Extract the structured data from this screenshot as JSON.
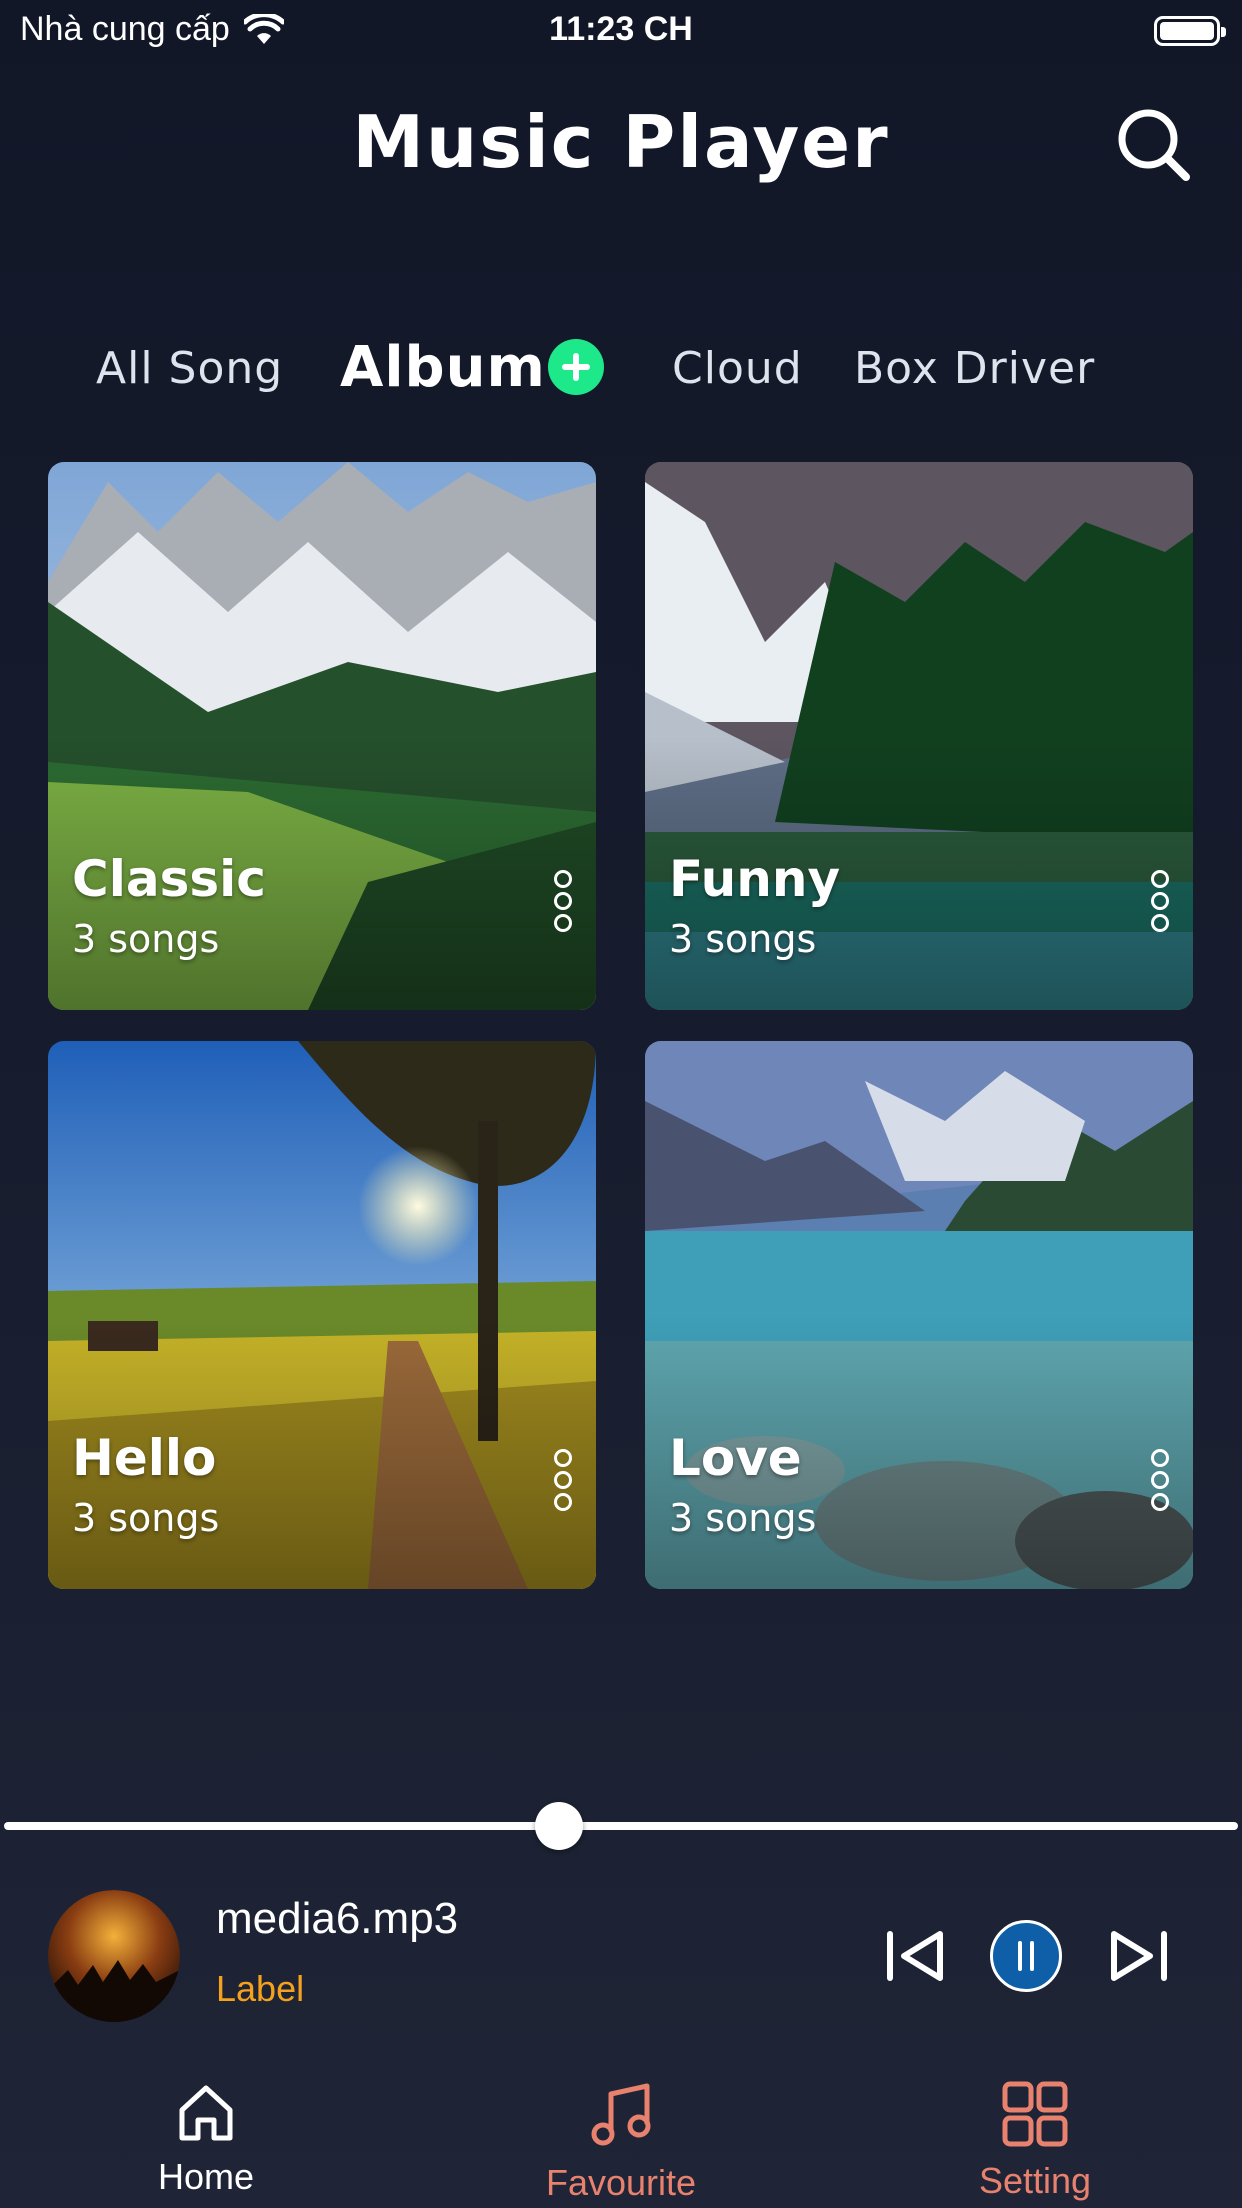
{
  "status_bar": {
    "carrier": "Nhà cung cấp",
    "time": "11:23 CH"
  },
  "header": {
    "title": "Music Player",
    "search_icon": "search-icon"
  },
  "tabs": [
    {
      "label": "All Song",
      "active": false
    },
    {
      "label": "Album",
      "active": true
    },
    {
      "label": "Cloud",
      "active": false
    },
    {
      "label": "Box Driver",
      "active": false
    }
  ],
  "albums": [
    {
      "name": "Classic",
      "count": "3 songs"
    },
    {
      "name": "Funny",
      "count": "3 songs"
    },
    {
      "name": "Hello",
      "count": "3 songs"
    },
    {
      "name": "Love",
      "count": "3 songs"
    }
  ],
  "player": {
    "progress": 0.45,
    "song": "media6.mp3",
    "artist": "Label",
    "state": "playing"
  },
  "nav": [
    {
      "label": "Home",
      "icon": "home-icon",
      "color": "#ffffff"
    },
    {
      "label": "Favourite",
      "icon": "music-note-icon",
      "color": "#e8826f"
    },
    {
      "label": "Setting",
      "icon": "grid-icon",
      "color": "#e8826f"
    }
  ],
  "colors": {
    "accent_add": "#1de98b",
    "play_button": "#0f5fa8",
    "artist_label": "#f4a11d",
    "inactive_nav": "#e8826f"
  }
}
